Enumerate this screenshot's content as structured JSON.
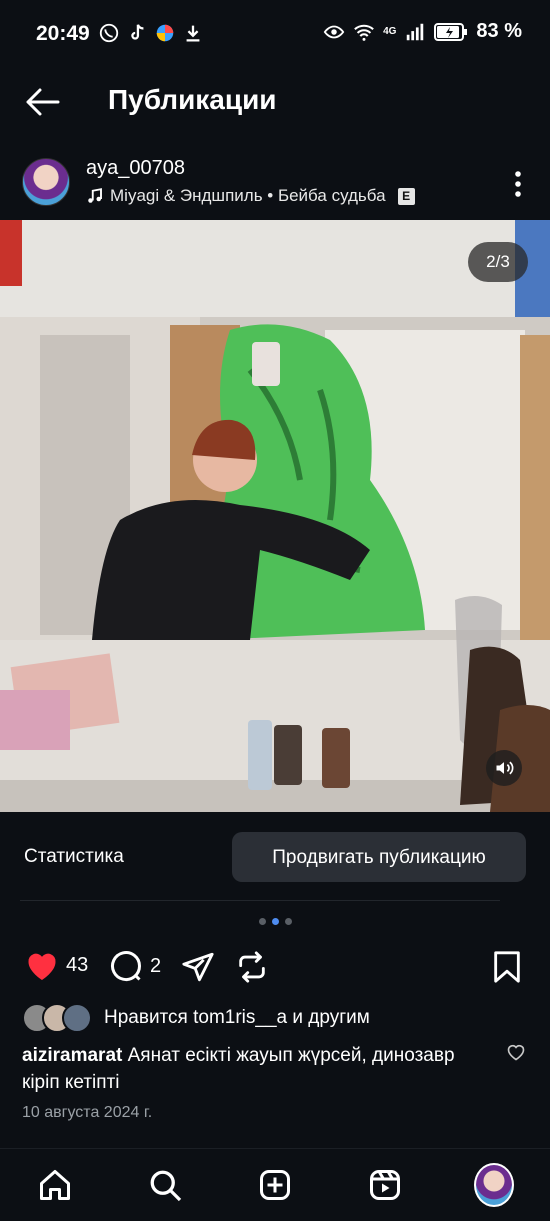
{
  "status_bar": {
    "time": "20:49",
    "network": "4G",
    "battery_percent": "83 %"
  },
  "header": {
    "title": "Публикации"
  },
  "post": {
    "username": "aya_00708",
    "music": "Miyagi & Эндшпиль • Бейба судьба",
    "explicit_badge": "E",
    "page_indicator": "2/3",
    "carousel": {
      "total": 3,
      "current": 2
    }
  },
  "controls": {
    "stats_label": "Статистика",
    "promote_label": "Продвигать публикацию"
  },
  "actions": {
    "likes_count": "43",
    "comments_count": "2"
  },
  "likes_summary": "Нравится tom1ris__a и другим",
  "caption": {
    "author": "aiziramarat",
    "text": "Аянат есікті жауып жүрсей, динозавр кіріп кетіпті"
  },
  "date": "10 августа 2024 г.",
  "colors": {
    "background": "#0c0f14",
    "like_red": "#ff3040",
    "button_bg": "#2b2f36",
    "dot_active": "#4e8cf0"
  },
  "icons": {
    "back": "arrow-left-icon",
    "more": "more-vertical-icon",
    "music": "music-note-icon",
    "like": "heart-filled-icon",
    "comment": "comment-icon",
    "share": "send-icon",
    "repost": "repost-icon",
    "save": "bookmark-icon",
    "sound": "volume-icon",
    "nav": [
      "home-icon",
      "search-icon",
      "create-icon",
      "reels-icon",
      "profile-avatar"
    ]
  }
}
